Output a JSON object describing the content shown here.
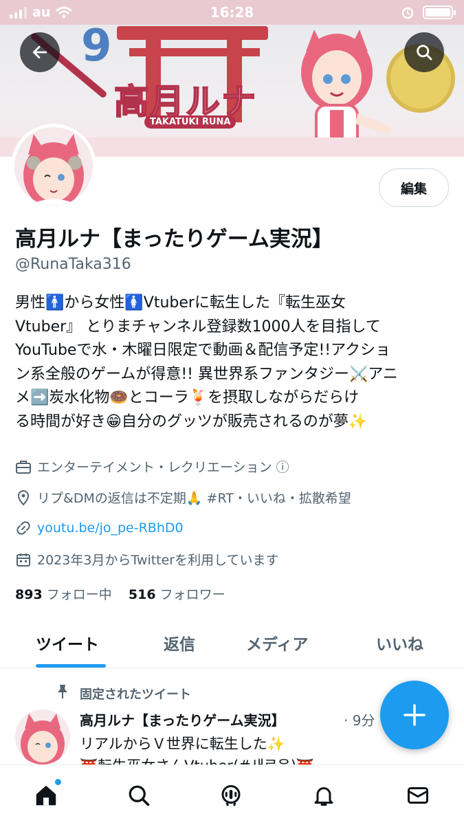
{
  "status_bar": {
    "carrier": "au",
    "time": "16:28"
  },
  "banner": {
    "title": "高月ルナ",
    "subtitle": "TAKATUKI RUNA",
    "number": "9"
  },
  "profile": {
    "edit_label": "編集",
    "display_name": "高月ルナ【まったりゲーム実況】",
    "handle": "@RunaTaka316",
    "bio_lines": [
      "男性🚹から女性🚺Vtuberに転生した『転生巫女",
      "Vtuber』 とりまチャンネル登録数1000人を目指して",
      "YouTubeで水・木曜日限定で動画＆配信予定!!アクショ",
      "ン系全般のゲームが得意!! 異世界系ファンタジー⚔️アニ",
      "メ➡️炭水化物🍩とコーラ🍹を摂取しながらだらけ",
      "る時間が好き😁自分のグッツが販売されるのが夢✨"
    ],
    "category": "エンターテイメント・レクリエーション ⓘ",
    "location": "リプ&DMの返信は不定期🙏 #RT・いいね・拡散希望",
    "url": "youtu.be/jo_pe-RBhD0",
    "joined": "2023年3月からTwitterを利用しています",
    "following_count": "893",
    "following_label": "フォロー中",
    "followers_count": "516",
    "followers_label": "フォロワー"
  },
  "tabs": [
    "ツイート",
    "返信",
    "メディア",
    "いいね"
  ],
  "pinned_tweet": {
    "pinned_label": "固定されたツイート",
    "author": "高月ルナ【まったりゲーム実況】",
    "time": "· 9分",
    "text_line1": "リアルからＶ世界に転生した✨",
    "text_line2": "⛩️転生巫女さんVtuber(#새로운)⛩️"
  },
  "colors": {
    "accent": "#1d9bf0",
    "torii": "#c8434b",
    "status_bar": "#e9c9d2"
  },
  "icons": {
    "back": "arrow-left-icon",
    "search": "search-icon",
    "fab": "plus-icon",
    "nav": [
      "home-icon",
      "search-icon",
      "spaces-icon",
      "bell-icon",
      "mail-icon"
    ]
  }
}
